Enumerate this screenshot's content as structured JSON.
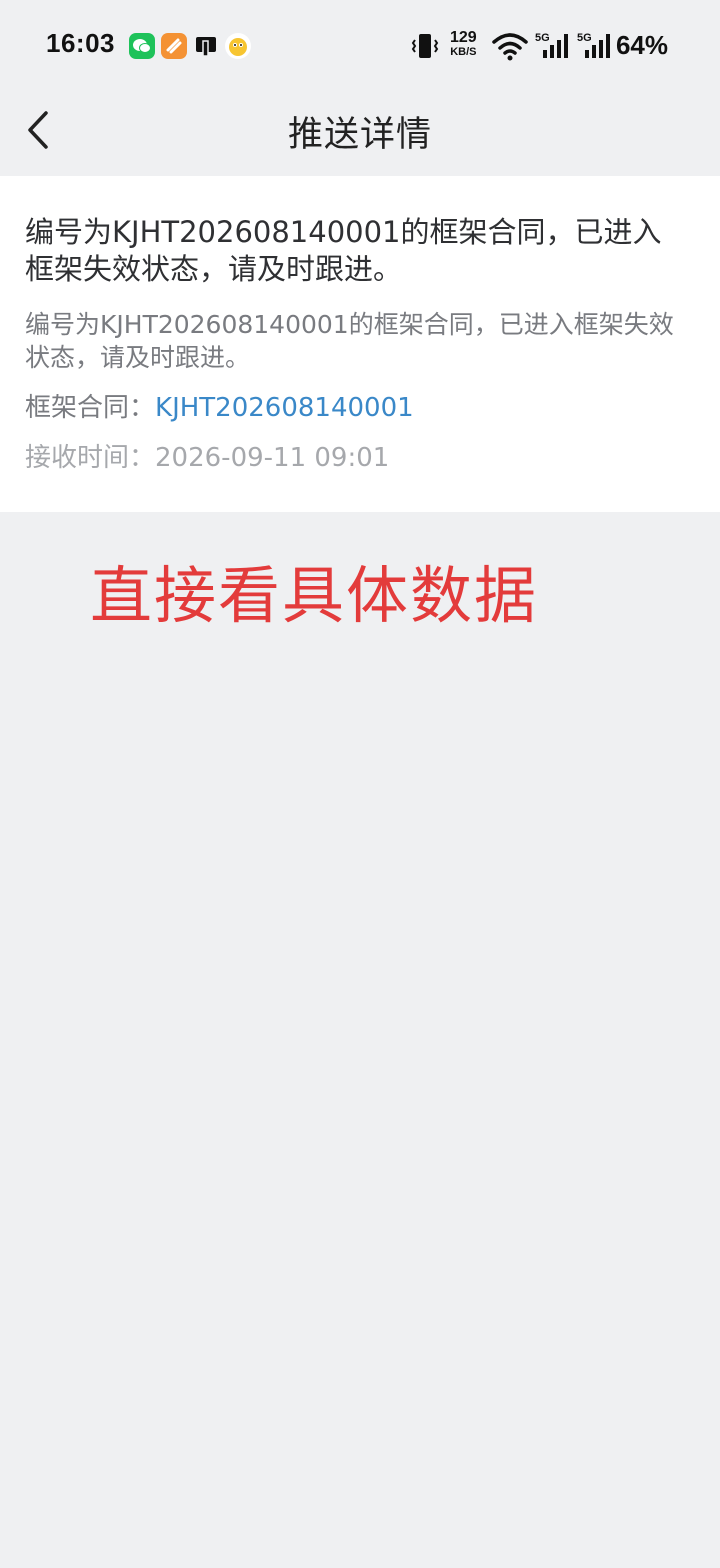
{
  "status_bar": {
    "time": "16:03",
    "net_speed_value": "129",
    "net_speed_unit": "KB/S",
    "signal_1_label": "5G",
    "signal_2_label": "5G",
    "battery": "64%",
    "icons": [
      "wechat-icon",
      "orange-app-icon",
      "square-app-icon",
      "emoji-app-icon",
      "vibrate-icon",
      "wifi-icon",
      "signal-icon",
      "signal-icon"
    ]
  },
  "nav": {
    "title": "推送详情",
    "back_icon": "chevron-left-icon"
  },
  "message": {
    "title": "编号为KJHT202608140001的框架合同，已进入框架失效状态，请及时跟进。",
    "body": "编号为KJHT202608140001的框架合同，已进入框架失效状态，请及时跟进。",
    "contract_label": "框架合同：",
    "contract_value": "KJHT202608140001",
    "time_label": "接收时间：",
    "time_value": "2026-09-11 09:01"
  },
  "annotation": {
    "text": "直接看具体数据",
    "color": "#e33b3b"
  },
  "colors": {
    "link": "#3a88c8",
    "background": "#eff0f2",
    "card": "#ffffff"
  }
}
